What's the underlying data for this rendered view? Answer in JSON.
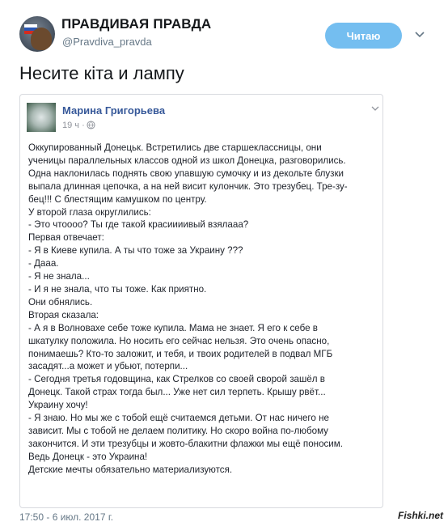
{
  "header": {
    "display_name": "ПРАВДИВАЯ ПРАВДА",
    "handle": "@Pravdiva_pravda",
    "follow_label": "Читаю",
    "follow_color": "#74bef0"
  },
  "tweet": {
    "text": "Несите кіта и лампу",
    "timestamp": "17:50 - 6 июл. 2017 г."
  },
  "embedded_post": {
    "author": "Марина Григорьева",
    "time": "19 ч ·",
    "author_color": "#365899",
    "lines": [
      "Оккупированный Донецьк. Встретились две старшеклассницы, они",
      "ученицы параллельных классов одной из школ Донецка, разговорились.",
      "Одна наклонилась поднять свою упавшую сумочку и из декольте блузки",
      "выпала длинная цепочка, а на ней висит кулончик. Это трезубец. Тре-зу-",
      "бец!!! С блестящим камушком по центру.",
      "У второй глаза округлились:",
      "- Это чтоооо? Ты где такой красиииивый взялааа?",
      "Первая отвечает:",
      "- Я в Киеве купила. А ты что тоже за Украину ???",
      "- Дааа.",
      "- Я не знала...",
      "- И я не знала, что ты тоже. Как приятно.",
      "Они обнялись.",
      "Вторая сказала:",
      "- А я в Волновахе себе тоже купила. Мама не знает. Я его к себе в",
      "шкатулку положила. Но носить его сейчас нельзя. Это очень опасно,",
      "понимаешь? Кто-то заложит, и тебя, и твоих родителей в подвал МГБ",
      "засадят...а может и убьют, потерпи...",
      "- Сегодня третья годовщина, как Стрелков со своей сворой зашёл в",
      "Донецк. Такой страх тогда был... Уже нет сил терпеть. Крышу рвёт...",
      "Украину хочу!",
      "- Я знаю. Но мы же с тобой ещё считаемся детьми. От нас ничего не",
      "зависит. Мы с тобой не делаем политику. Но скоро война по-любому",
      "закончится. И эти трезубцы и жовто-блакитни флажки мы ещё поносим.",
      "Ведь Донецк - это Украина!",
      "Детские мечты обязательно материализуются."
    ]
  },
  "watermark": "Fishki.net",
  "icons": {
    "avatar": "profile-avatar",
    "chevron": "chevron-down-icon",
    "globe": "globe-icon"
  }
}
